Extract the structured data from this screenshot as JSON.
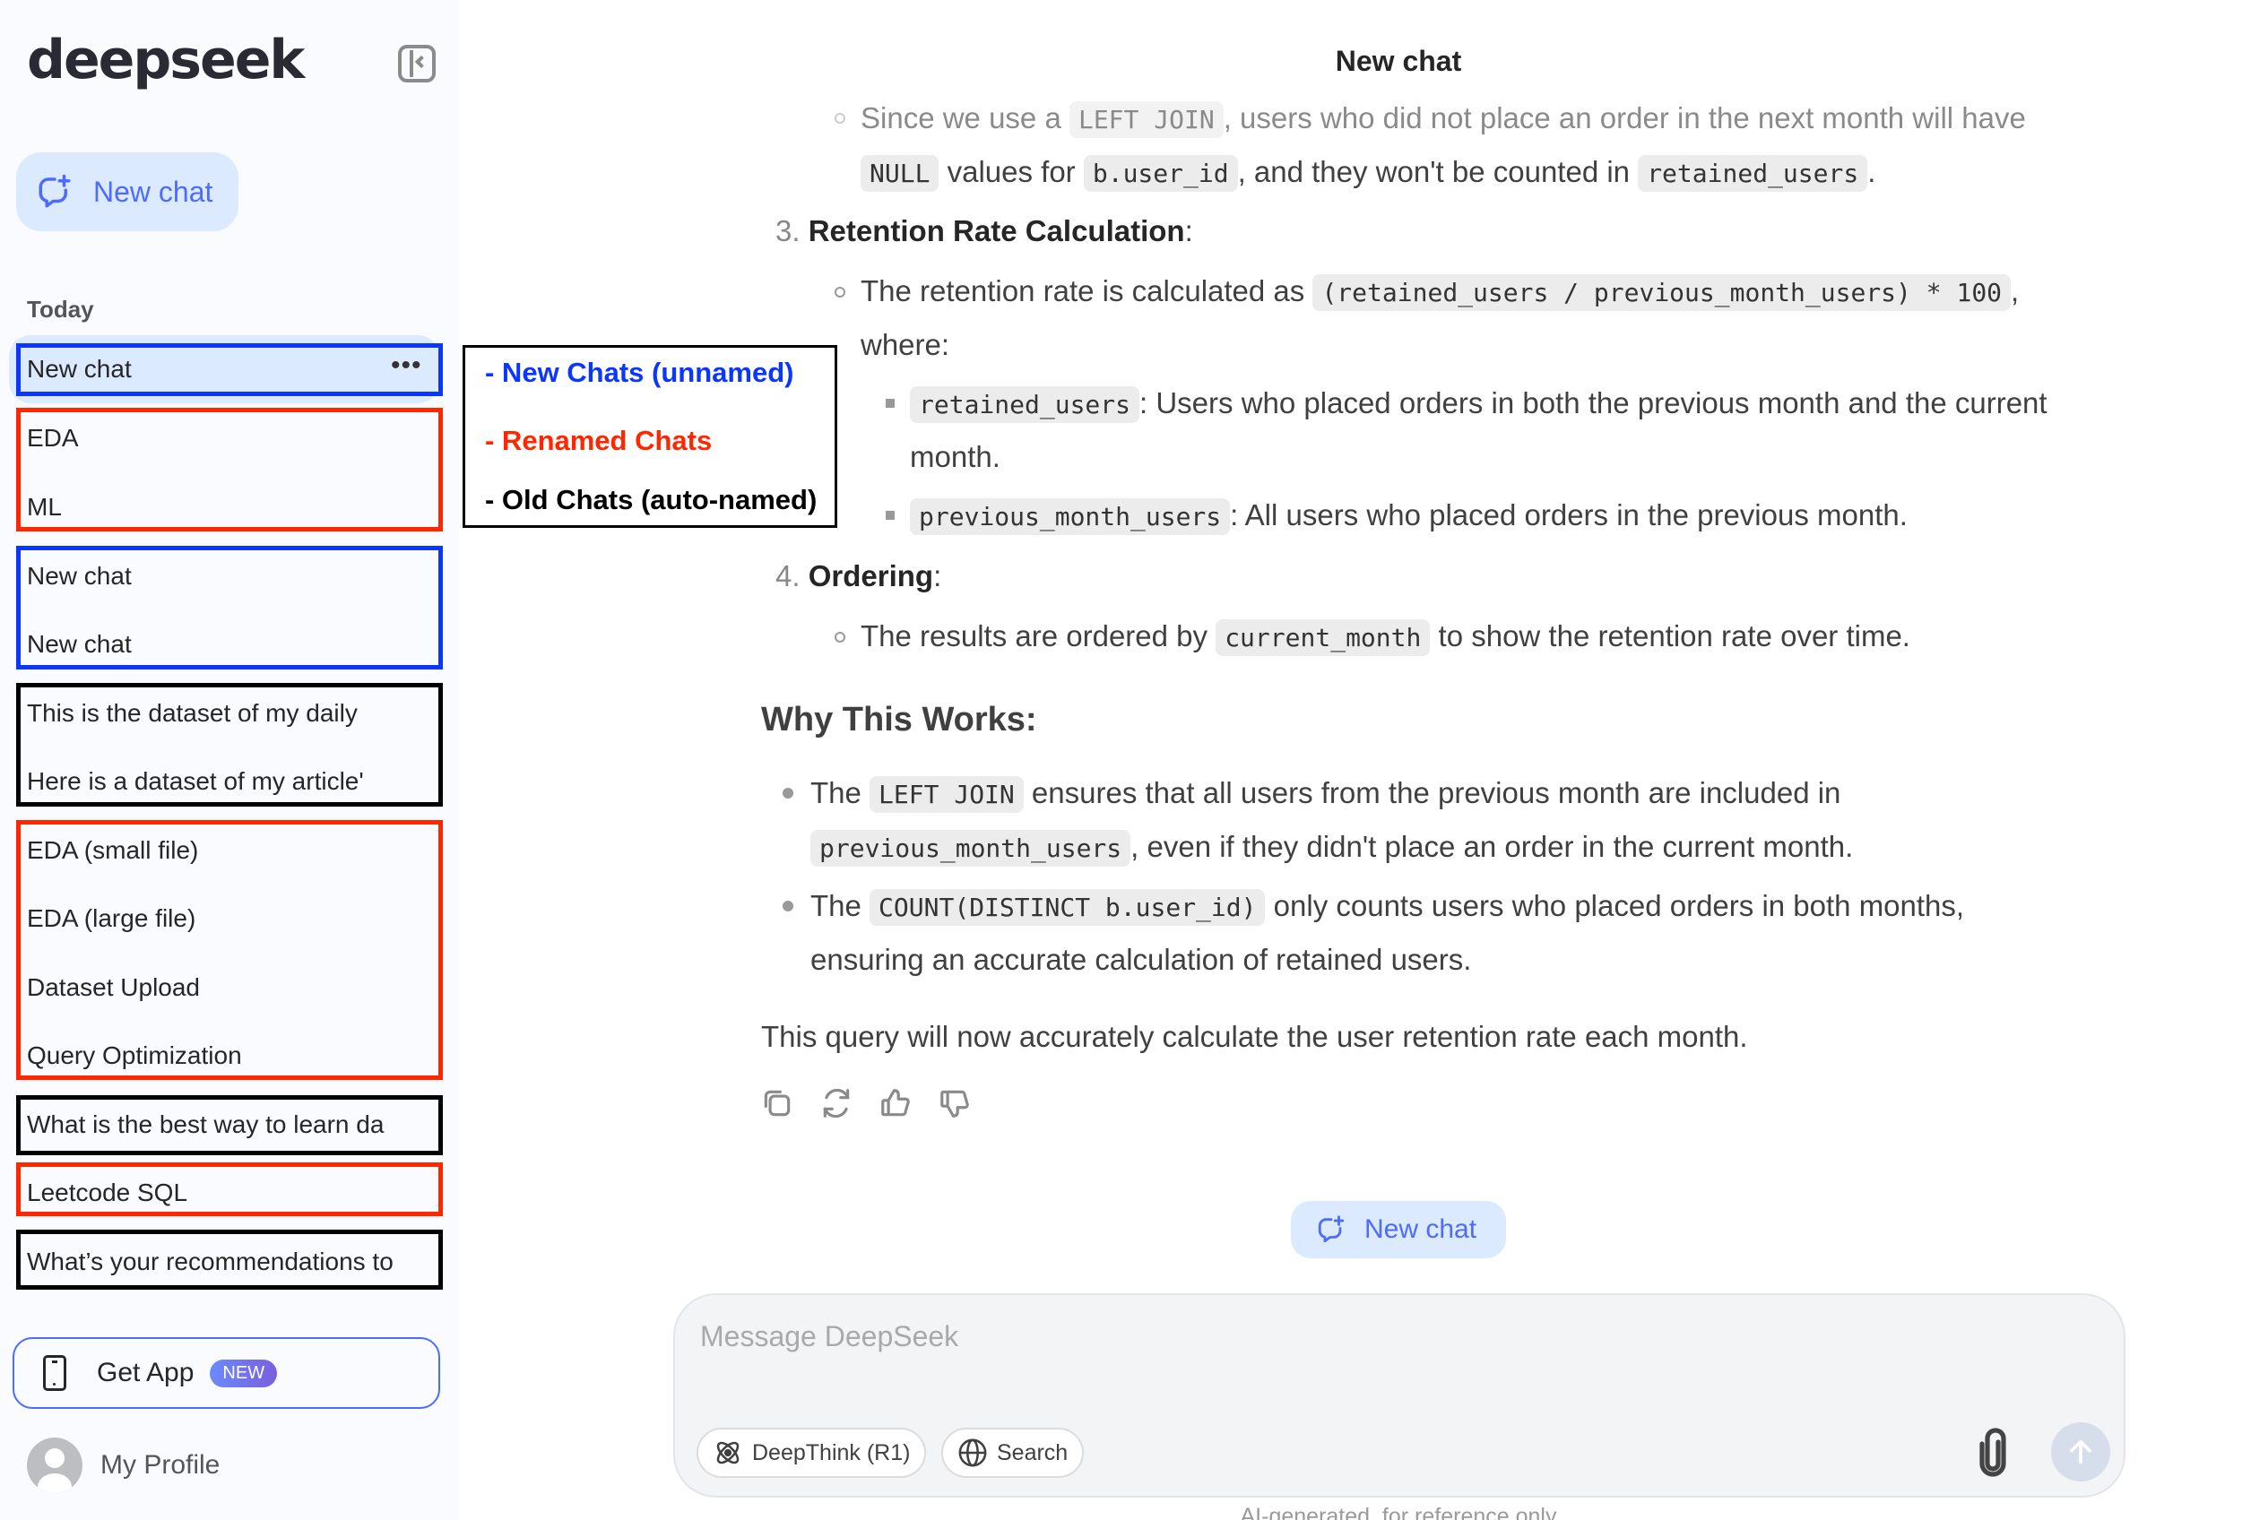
{
  "sidebar": {
    "logo": "deepseek",
    "new_chat_label": "New chat",
    "section_today": "Today",
    "chats": [
      {
        "title": "New chat",
        "group": "new"
      },
      {
        "title": "EDA",
        "group": "renamed"
      },
      {
        "title": "ML",
        "group": "renamed"
      },
      {
        "title": "New chat",
        "group": "new"
      },
      {
        "title": "New chat",
        "group": "new"
      },
      {
        "title": "This is the dataset of my daily",
        "group": "old"
      },
      {
        "title": "Here is a dataset of my article'",
        "group": "old"
      },
      {
        "title": "EDA (small file)",
        "group": "renamed"
      },
      {
        "title": "EDA (large file)",
        "group": "renamed"
      },
      {
        "title": "Dataset Upload",
        "group": "renamed"
      },
      {
        "title": "Query Optimization",
        "group": "renamed"
      },
      {
        "title": "What is the best way to learn da",
        "group": "old"
      },
      {
        "title": "Leetcode SQL",
        "group": "renamed"
      },
      {
        "title": "What’s your recommendations to",
        "group": "old"
      }
    ],
    "get_app_label": "Get App",
    "new_badge": "NEW",
    "profile_label": "My Profile"
  },
  "legend": {
    "new": "- New Chats (unnamed)",
    "renamed": "- Renamed Chats",
    "old": "- Old Chats (auto-named)",
    "colors": {
      "new": "#0a36ff",
      "renamed": "#ff2600",
      "old": "#000000"
    }
  },
  "header": {
    "title": "New chat"
  },
  "message": {
    "l1a": "Since we use a ",
    "l1code": "LEFT JOIN",
    "l1b": ", users who did not place an order in the next month will have",
    "l2code1": "NULL",
    "l2a": " values for ",
    "l2code2": "b.user_id",
    "l2b": ", and they won't be counted in ",
    "l2code3": "retained_users",
    "l2c": ".",
    "item3_num": "3.",
    "item3_title": "Retention Rate Calculation",
    "colon": ":",
    "l3a": "The retention rate is calculated as ",
    "l3code": "(retained_users / previous_month_users) * 100",
    "l3b": ",",
    "l4": "where:",
    "l5code": "retained_users",
    "l5a": ": Users who placed orders in both the previous month and the current",
    "l6": "month.",
    "l7code": "previous_month_users",
    "l7a": ": All users who placed orders in the previous month.",
    "item4_num": "4.",
    "item4_title": "Ordering",
    "l8a": "The results are ordered by ",
    "l8code": "current_month",
    "l8b": " to show the retention rate over time.",
    "heading": "Why This Works:",
    "b1a": "The ",
    "b1code": "LEFT JOIN",
    "b1b": " ensures that all users from the previous month are included in",
    "b1code2": "previous_month_users",
    "b1c": ", even if they didn't place an order in the current month.",
    "b2a": "The ",
    "b2code": "COUNT(DISTINCT b.user_id)",
    "b2b": " only counts users who placed orders in both months,",
    "b2c": "ensuring an accurate calculation of retained users.",
    "closing": "This query will now accurately calculate the user retention rate each month."
  },
  "center_new_chat": "New chat",
  "composer": {
    "placeholder": "Message DeepSeek",
    "deepthink_label": "DeepThink (R1)",
    "search_label": "Search"
  },
  "footnote": "AI-generated, for reference only"
}
